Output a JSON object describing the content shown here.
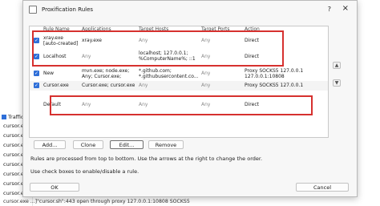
{
  "background": {
    "traffic_label": "Traffic",
    "rows": [
      "cursor.exe",
      "cursor.exe",
      "cursor.exe",
      "cursor.exe",
      "cursor.exe",
      "cursor.exe",
      "cursor.exe",
      "cursor.exe"
    ],
    "bottom_text": "cursor.exe   ...]\"cursor.sh\":443 open through proxy 127.0.0.1:10808 SOCKS5"
  },
  "dialog": {
    "title": "Proxification Rules",
    "help_icon": "?",
    "close_icon": "×"
  },
  "table": {
    "headers": [
      "Rule Name",
      "Applications",
      "Target Hosts",
      "Target Ports",
      "Action"
    ],
    "rows": [
      {
        "name": "xray.exe",
        "name2": "[auto-created]",
        "applications": "xray.exe",
        "hosts": "Any",
        "hosts2": "",
        "ports": "Any",
        "action": "Direct"
      },
      {
        "name": "Localhost",
        "name2": "",
        "applications": "Any",
        "hosts": "localhost; 127.0.0.1;",
        "hosts2": "%ComputerName%; ::1",
        "ports": "Any",
        "action": "Direct"
      },
      {
        "name": "New",
        "name2": "",
        "applications": "mvn.exe; node.exe;",
        "applications2": "Any; Cursor.exe;",
        "hosts": "*.github.com;",
        "hosts2": "*.githubusercontent.co...",
        "ports": "Any",
        "action": "Proxy SOCKS5 127.0.0.1",
        "action2": "127.0.0.1:10808"
      },
      {
        "name": "Cursor.exe",
        "name2": "",
        "applications": "Cursor.exe; cursor.exe",
        "hosts": "Any",
        "hosts2": "",
        "ports": "Any",
        "action": "Proxy SOCKS5 127.0.0.1"
      },
      {
        "name": "Default",
        "name2": "",
        "applications": "Any",
        "hosts": "Any",
        "hosts2": "",
        "ports": "Any",
        "action": "Direct"
      }
    ]
  },
  "arrows": {
    "up": "▲",
    "down": "▼"
  },
  "buttons": {
    "add": "Add...",
    "clone": "Clone",
    "edit": "Edit...",
    "remove": "Remove",
    "ok": "OK",
    "cancel": "Cancel"
  },
  "info": {
    "line1": "Rules are processed from top to bottom. Use the arrows at the right to change the order.",
    "line2": "Use check boxes to enable/disable a rule."
  },
  "colors": {
    "accent": "#2f6fd8",
    "highlight_red": "#d6312f"
  }
}
